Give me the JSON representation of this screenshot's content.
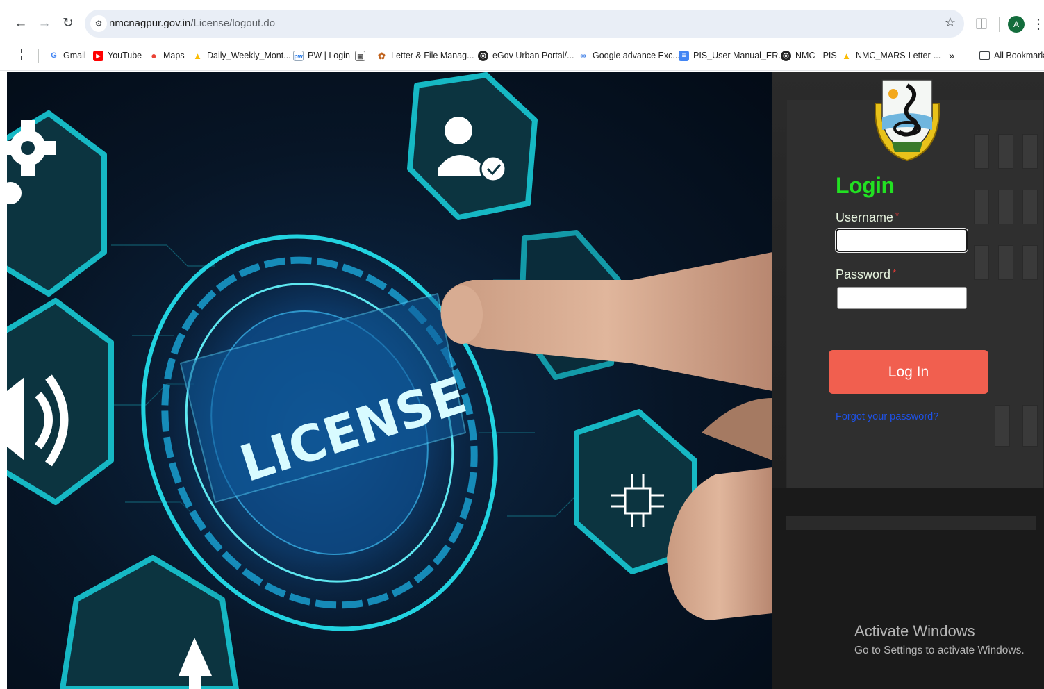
{
  "browser": {
    "url_host": "nmcnagpur.gov.in",
    "url_path": "/License/logout.do",
    "avatar_letter": "A",
    "bookmarks": [
      {
        "label": "Gmail",
        "icon": "google-icon"
      },
      {
        "label": "YouTube",
        "icon": "youtube-icon"
      },
      {
        "label": "Maps",
        "icon": "maps-icon"
      },
      {
        "label": "Daily_Weekly_Mont...",
        "icon": "drive-icon"
      },
      {
        "label": "PW | Login",
        "icon": "pw-icon"
      },
      {
        "label": "",
        "icon": "image-icon"
      },
      {
        "label": "Letter & File Manag...",
        "icon": "emblem-icon"
      },
      {
        "label": "eGov Urban Portal/...",
        "icon": "globe-icon"
      },
      {
        "label": "Google advance Exc...",
        "icon": "chart-icon"
      },
      {
        "label": "PIS_User Manual_ER...",
        "icon": "docs-icon"
      },
      {
        "label": "NMC - PIS",
        "icon": "globe-icon"
      },
      {
        "label": "NMC_MARS-Letter-...",
        "icon": "drive-icon"
      }
    ],
    "more_label": "»",
    "all_bookmarks_label": "All Bookmarks"
  },
  "hero": {
    "badge_text": "LICENSE"
  },
  "login": {
    "title": "Login",
    "username_label": "Username",
    "password_label": "Password",
    "required_mark": "*",
    "username_value": "",
    "password_value": "",
    "button_label": "Log In",
    "forgot_label": "Forgot your password?"
  },
  "watermark": {
    "title": "Activate Windows",
    "subtitle": "Go to Settings to activate Windows."
  }
}
